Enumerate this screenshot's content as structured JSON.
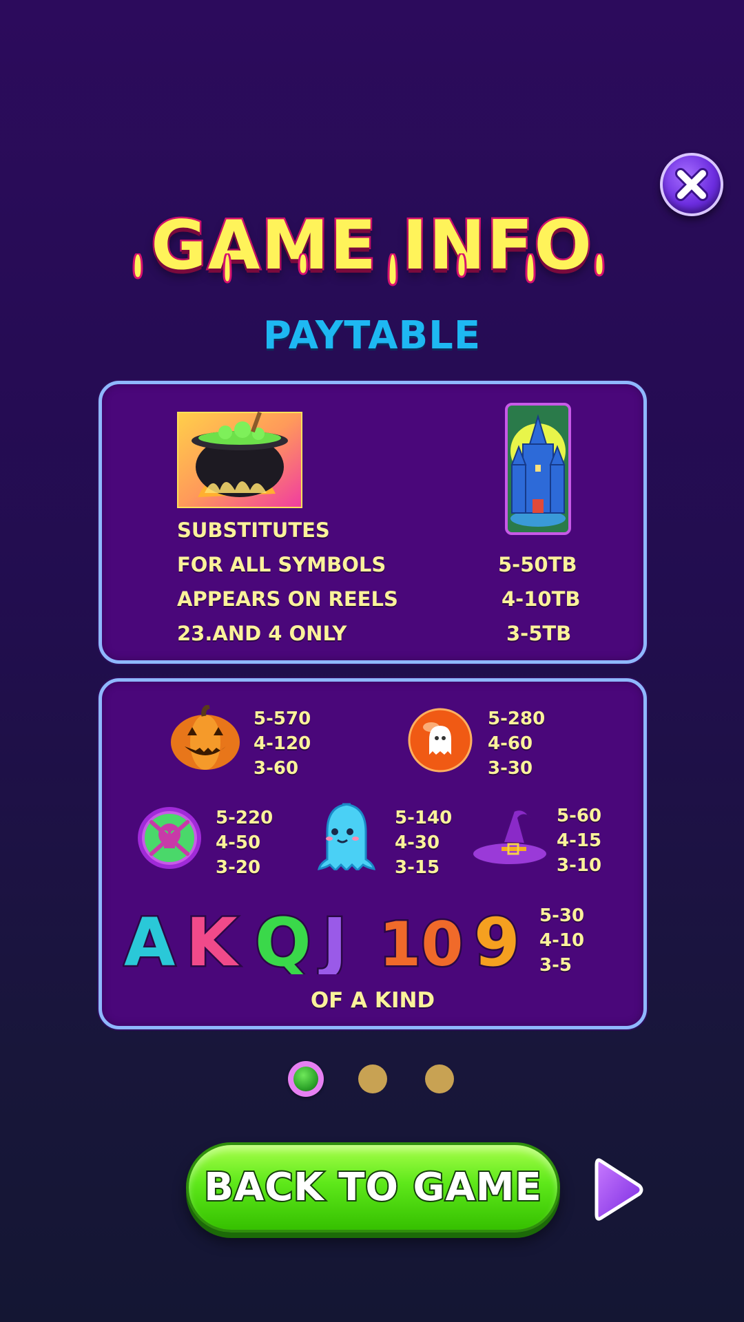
{
  "header": {
    "title": "GAME INFO",
    "subtitle": "PAYTABLE",
    "close_icon": "close-icon"
  },
  "panel_top": {
    "wild_icon": "cauldron-icon",
    "wild_text": [
      "SUBSTITUTES",
      "FOR ALL SYMBOLS",
      "APPEARS ON REELS",
      "23.AND 4 ONLY"
    ],
    "scatter_icon": "castle-icon",
    "scatter_pays": [
      "5-50TB",
      "4-10TB",
      "3-5TB"
    ]
  },
  "panel_bottom": {
    "symbols": [
      {
        "icon": "pumpkin-icon",
        "pays": [
          "5-570",
          "4-120",
          "3-60"
        ]
      },
      {
        "icon": "ghost-orb-icon",
        "pays": [
          "5-280",
          "4-60",
          "3-30"
        ]
      },
      {
        "icon": "skull-coin-icon",
        "pays": [
          "5-220",
          "4-50",
          "3-20"
        ]
      },
      {
        "icon": "ghost-icon",
        "pays": [
          "5-140",
          "4-30",
          "3-15"
        ]
      },
      {
        "icon": "witch-hat-icon",
        "pays": [
          "5-60",
          "4-15",
          "3-10"
        ]
      }
    ],
    "letters": [
      "A",
      "K",
      "Q",
      "J",
      "10",
      "9"
    ],
    "letters_pays": [
      "5-30",
      "4-10",
      "3-5"
    ],
    "of_a_kind": "OF A KIND"
  },
  "pagination": {
    "current": 1,
    "total": 3
  },
  "footer": {
    "back_label": "BACK TO GAME",
    "next_icon": "play-arrow-icon"
  },
  "colors": {
    "title": "#fff35a",
    "title_outline": "#d6126f",
    "subtitle": "#1eb8f2",
    "panel": "#4a077a",
    "panel_border": "#8fb8ff",
    "pay_text": "#fbf29b",
    "button": "#5ee81a"
  }
}
